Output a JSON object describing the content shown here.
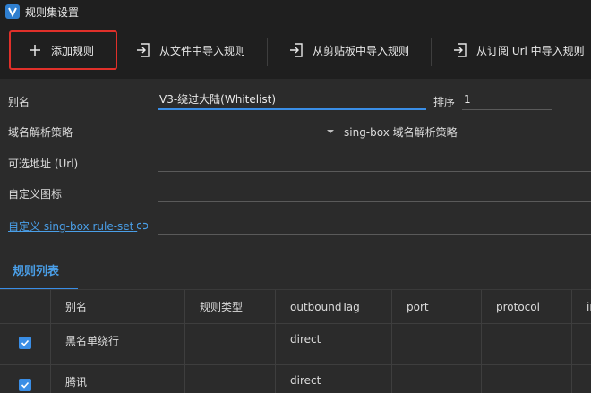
{
  "window": {
    "title": "规则集设置"
  },
  "toolbar": {
    "add_rule": "添加规则",
    "import_file": "从文件中导入规则",
    "import_clipboard": "从剪贴板中导入规则",
    "import_url": "从订阅 Url 中导入规则"
  },
  "form": {
    "alias_label": "别名",
    "alias_value": "V3-绕过大陆(Whitelist)",
    "sort_label": "排序",
    "sort_value": "1",
    "dns_strategy_label": "域名解析策略",
    "dns_strategy_value": "",
    "singbox_dns_label": "sing-box 域名解析策略",
    "singbox_dns_value": "",
    "url_label": "可选地址 (Url)",
    "url_value": "",
    "icon_label": "自定义图标",
    "icon_value": "",
    "ruleset_link": "自定义 sing-box rule-set",
    "ruleset_value": ""
  },
  "tabs": {
    "rules_list": "规则列表"
  },
  "table": {
    "headers": [
      "",
      "别名",
      "规则类型",
      "outboundTag",
      "port",
      "protocol",
      "in"
    ],
    "rows": [
      {
        "checked": true,
        "alias": "黑名单绕行",
        "type": "",
        "outbound": "direct",
        "port": "",
        "protocol": ""
      },
      {
        "checked": true,
        "alias": "腾讯",
        "type": "",
        "outbound": "direct",
        "port": "",
        "protocol": ""
      }
    ]
  },
  "colors": {
    "accent": "#3a8ee6",
    "highlight_border": "#e0302a",
    "background": "#2b2b2b",
    "toolbar": "#1f1f1f"
  }
}
